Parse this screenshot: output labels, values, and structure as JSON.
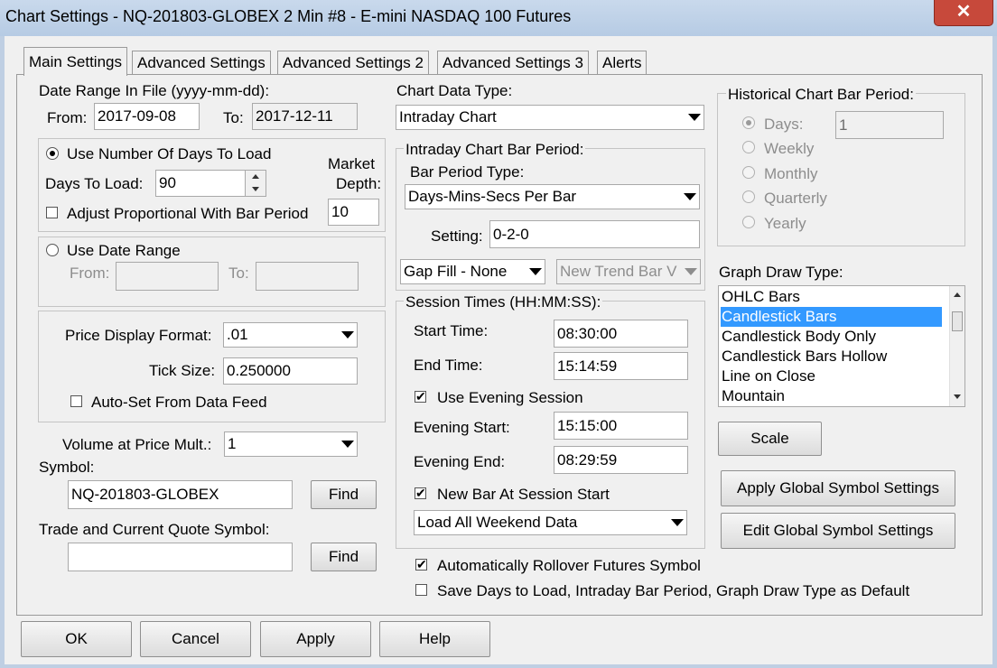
{
  "window": {
    "title": "Chart Settings - NQ-201803-GLOBEX  2 Min   #8 - E-mini NASDAQ 100 Futures",
    "close_glyph": "✕"
  },
  "tabs": [
    {
      "label": "Main Settings",
      "active": true
    },
    {
      "label": "Advanced Settings",
      "active": false
    },
    {
      "label": "Advanced Settings 2",
      "active": false
    },
    {
      "label": "Advanced Settings 3",
      "active": false
    },
    {
      "label": "Alerts",
      "active": false
    }
  ],
  "date_range": {
    "heading": "Date Range In File (yyyy-mm-dd):",
    "from_label": "From:",
    "from_value": "2017-09-08",
    "to_label": "To:",
    "to_value": "2017-12-11"
  },
  "load": {
    "use_days_label": "Use Number Of Days To Load",
    "use_days_selected": true,
    "days_label": "Days To Load:",
    "days_value": "90",
    "market_depth_label_1": "Market",
    "market_depth_label_2": "Depth:",
    "market_depth_value": "10",
    "adjust_label": "Adjust Proportional With Bar Period",
    "adjust_checked": false,
    "use_range_label": "Use Date Range",
    "use_range_selected": false,
    "range_from_label": "From:",
    "range_to_label": "To:"
  },
  "price": {
    "format_label": "Price Display Format:",
    "format_value": ".01",
    "tick_label": "Tick Size:",
    "tick_value": "0.250000",
    "autoset_label": "Auto-Set From Data Feed",
    "autoset_checked": false
  },
  "volume": {
    "label": "Volume at Price Mult.:",
    "value": "1"
  },
  "symbol": {
    "label": "Symbol:",
    "value": "NQ-201803-GLOBEX",
    "find_label": "Find",
    "trade_label": "Trade and Current Quote Symbol:",
    "trade_value": "",
    "find2_label": "Find"
  },
  "chart_data_type": {
    "label": "Chart Data Type:",
    "value": "Intraday Chart"
  },
  "intraday": {
    "group_label": "Intraday Chart Bar Period:",
    "period_type_label": "Bar Period Type:",
    "period_type_value": "Days-Mins-Secs Per Bar",
    "setting_label": "Setting:",
    "setting_value": "0-2-0",
    "gap_fill_value": "Gap Fill - None",
    "new_trend_value": "New Trend Bar V"
  },
  "session": {
    "group_label": "Session Times (HH:MM:SS):",
    "start_label": "Start Time:",
    "start_value": "08:30:00",
    "end_label": "End Time:",
    "end_value": "15:14:59",
    "use_evening_label": "Use Evening Session",
    "use_evening_checked": true,
    "evening_start_label": "Evening Start:",
    "evening_start_value": "15:15:00",
    "evening_end_label": "Evening End:",
    "evening_end_value": "08:29:59",
    "new_bar_label": "New Bar At Session Start",
    "new_bar_checked": true,
    "weekend_value": "Load All Weekend Data"
  },
  "historical": {
    "group_label": "Historical Chart Bar Period:",
    "days_label": "Days:",
    "days_value": "1",
    "options": [
      {
        "label": "Days:",
        "selected": true
      },
      {
        "label": "Weekly",
        "selected": false
      },
      {
        "label": "Monthly",
        "selected": false
      },
      {
        "label": "Quarterly",
        "selected": false
      },
      {
        "label": "Yearly",
        "selected": false
      }
    ]
  },
  "graph_draw": {
    "label": "Graph Draw Type:",
    "items": [
      {
        "label": "OHLC Bars",
        "selected": false
      },
      {
        "label": "Candlestick Bars",
        "selected": true
      },
      {
        "label": "Candlestick Body Only",
        "selected": false
      },
      {
        "label": "Candlestick Bars Hollow",
        "selected": false
      },
      {
        "label": "Line on Close",
        "selected": false
      },
      {
        "label": "Mountain",
        "selected": false
      }
    ]
  },
  "buttons": {
    "scale": "Scale",
    "apply_global": "Apply Global Symbol Settings",
    "edit_global": "Edit Global Symbol Settings",
    "ok": "OK",
    "cancel": "Cancel",
    "apply": "Apply",
    "help": "Help"
  },
  "bottom": {
    "rollover_label": "Automatically Rollover Futures Symbol",
    "rollover_checked": true,
    "save_default_label": "Save Days to Load, Intraday Bar Period, Graph Draw Type as Default",
    "save_default_checked": false
  },
  "glyphs": {
    "check": "✔"
  },
  "colors": {
    "selection": "#3399ff",
    "close_button": "#c7493b",
    "titlebar": "#bfcfe3"
  }
}
